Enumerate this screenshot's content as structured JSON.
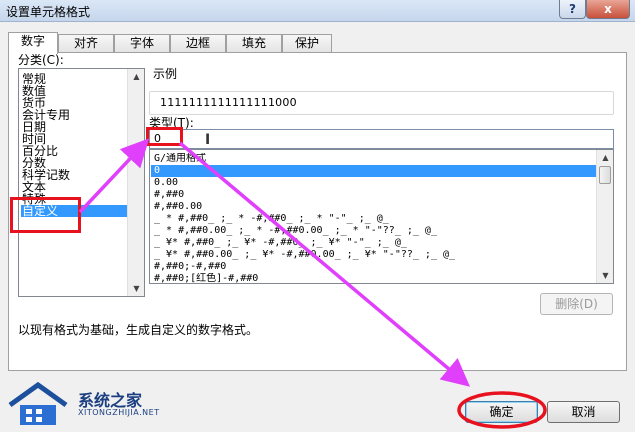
{
  "window": {
    "title": "设置单元格格式",
    "help_glyph": "?",
    "close_glyph": "x"
  },
  "tabs": [
    "数字",
    "对齐",
    "字体",
    "边框",
    "填充",
    "保护"
  ],
  "category": {
    "label": "分类(C):",
    "items": [
      "常规",
      "数值",
      "货币",
      "会计专用",
      "日期",
      "时间",
      "百分比",
      "分数",
      "科学记数",
      "文本",
      "特殊",
      "自定义"
    ],
    "selected_index": 11
  },
  "sample": {
    "label": "示例",
    "value": "1111111111111111000"
  },
  "type": {
    "label": "类型(T):",
    "value": "0",
    "formats": [
      "G/通用格式",
      "0",
      "0.00",
      "#,##0",
      "#,##0.00",
      "_ * #,##0_ ;_ * -#,##0_ ;_ * \"-\"_ ;_ @_",
      "_ * #,##0.00_ ;_ * -#,##0.00_ ;_ * \"-\"??_ ;_ @_",
      "_ ¥* #,##0_ ;_ ¥* -#,##0_ ;_ ¥* \"-\"_ ;_ @_",
      "_ ¥* #,##0.00_ ;_ ¥* -#,##0.00_ ;_ ¥* \"-\"??_ ;_ @_",
      "#,##0;-#,##0",
      "#,##0;[红色]-#,##0"
    ],
    "selected_index": 1
  },
  "buttons": {
    "delete": "删除(D)",
    "ok": "确定",
    "cancel": "取消"
  },
  "description": "以现有格式为基础，生成自定义的数字格式。",
  "annotations": {
    "color": "#e8111e",
    "arrow_color": "#e040fb"
  },
  "watermark": {
    "name": "系统之家",
    "url": "XITONGZHIJIA.NET"
  }
}
